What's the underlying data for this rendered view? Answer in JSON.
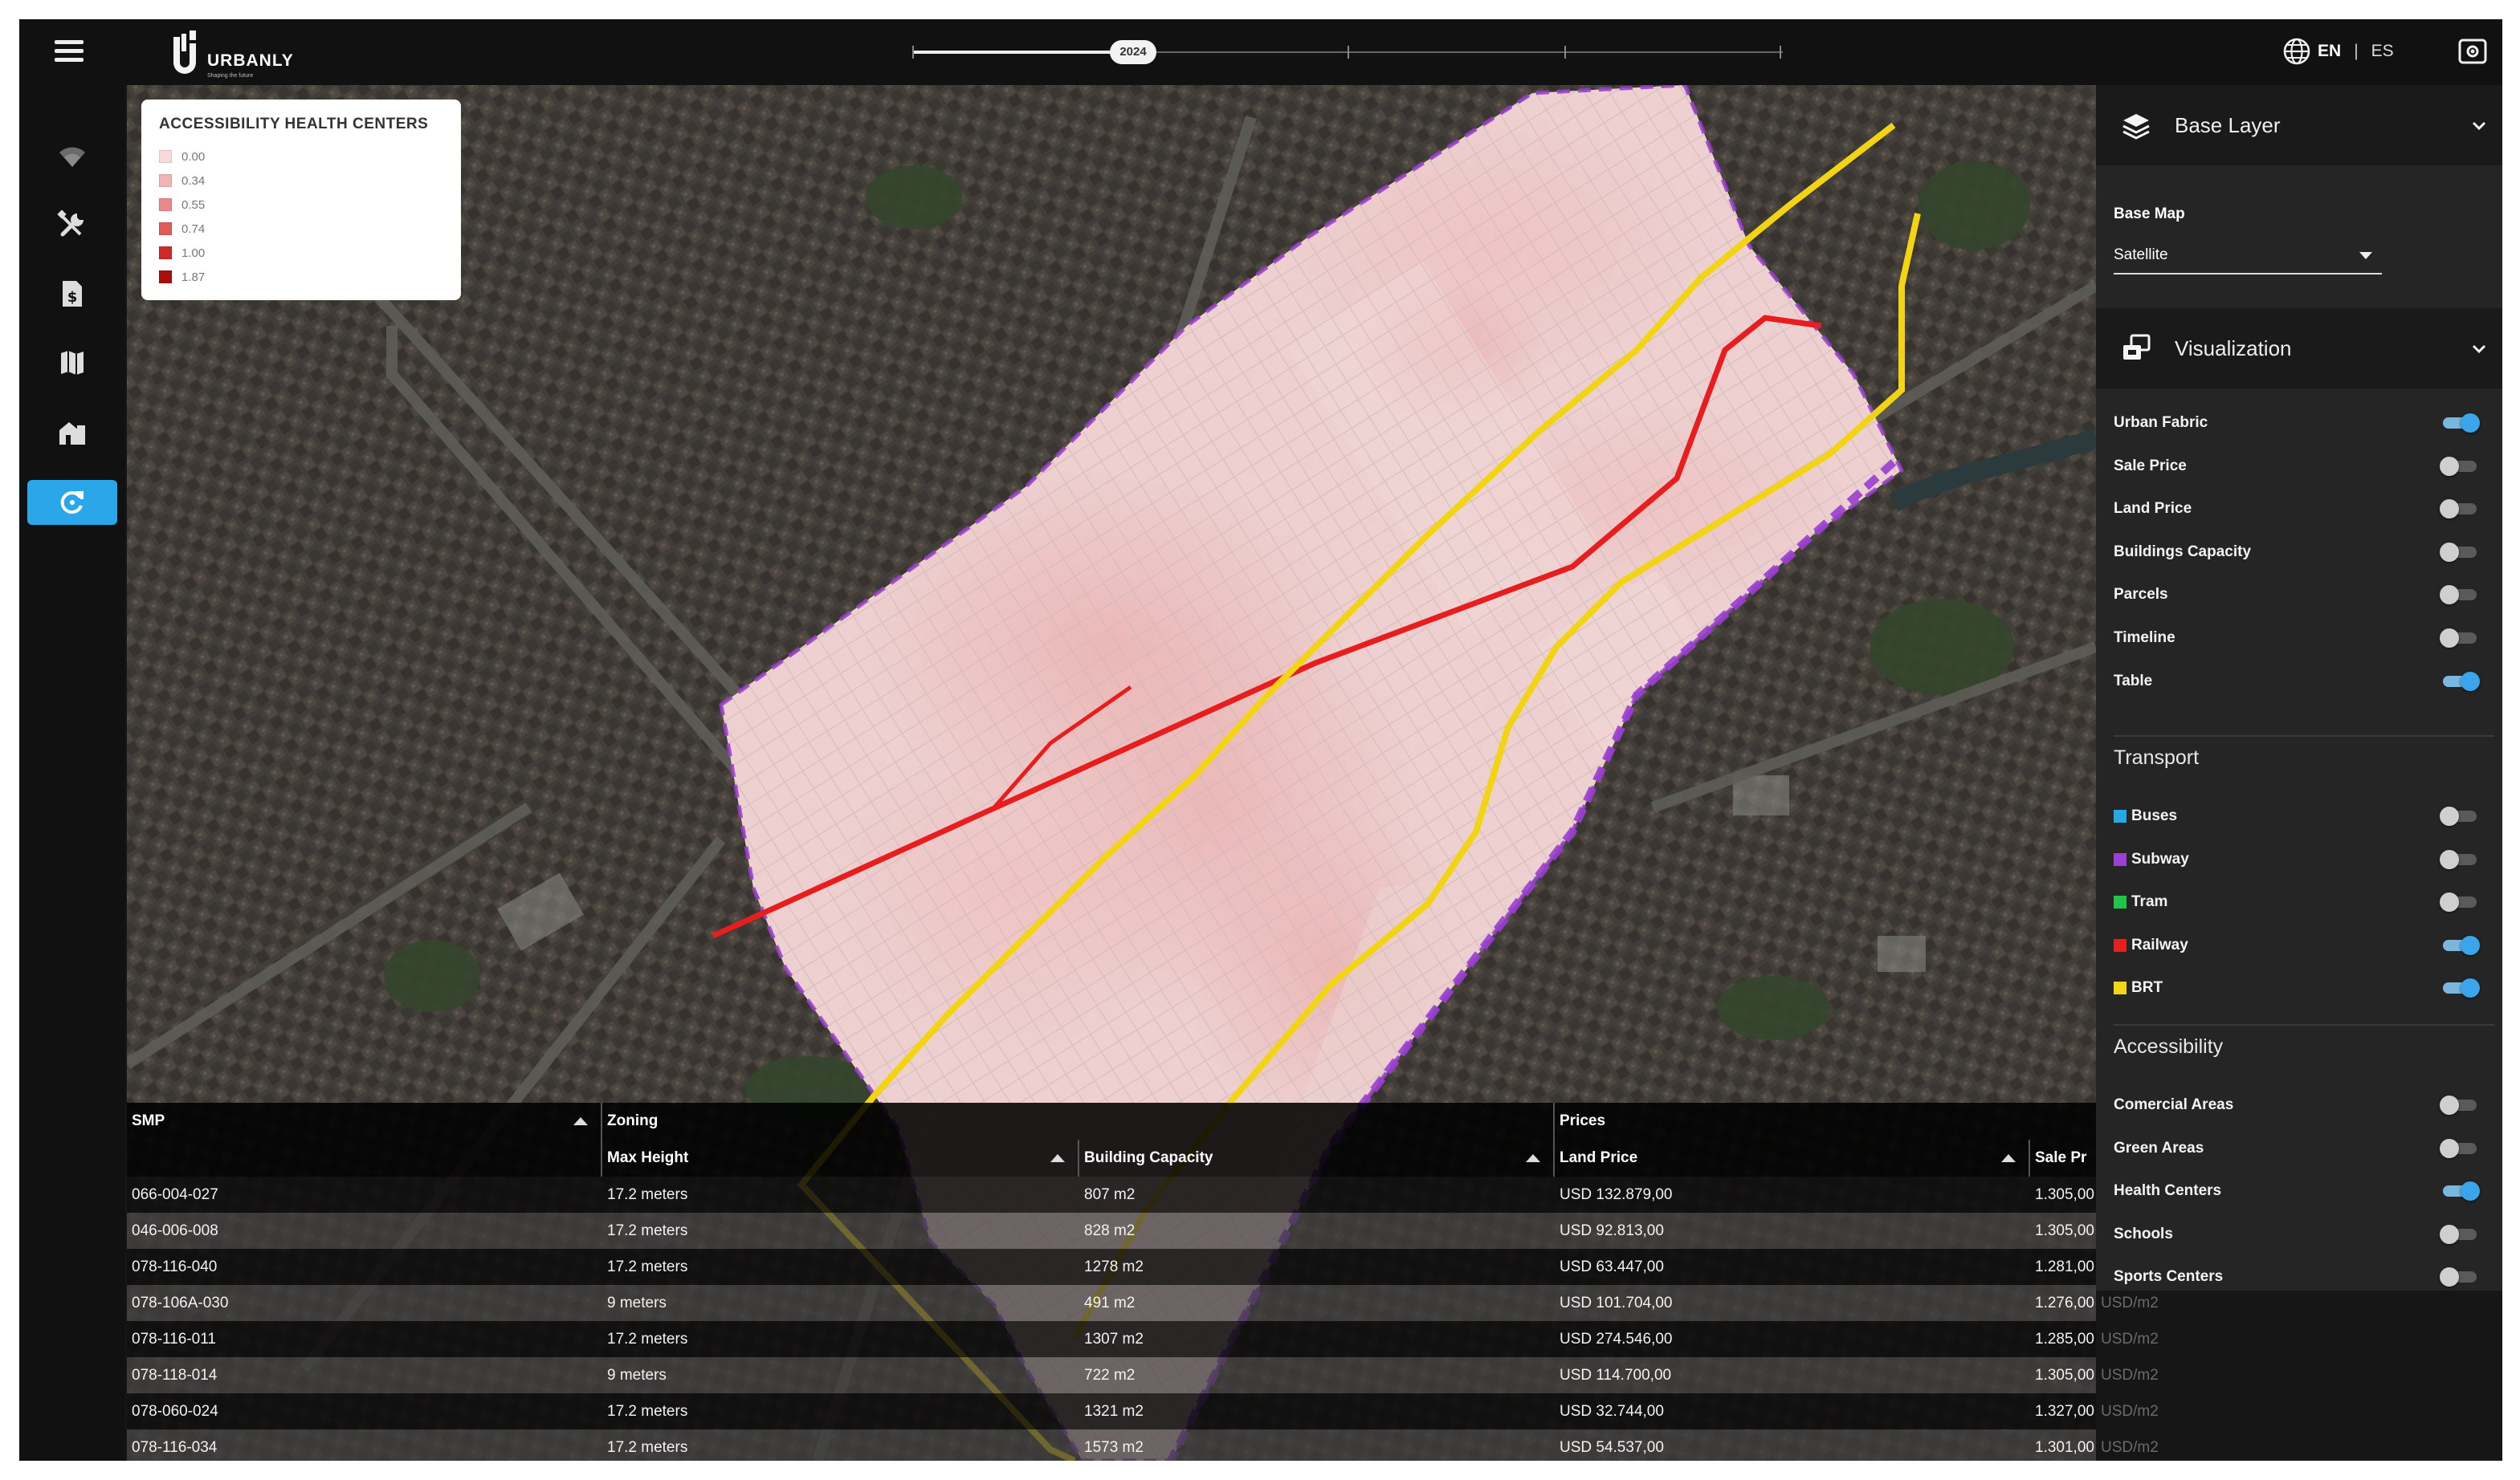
{
  "app": {
    "brand": "URBANLY",
    "tagline": "Shaping the future",
    "timeline_year": "2024"
  },
  "language": {
    "active": "EN",
    "other": "ES"
  },
  "sidebar": {
    "items": [
      {
        "name": "wifi",
        "icon": "wifi-icon"
      },
      {
        "name": "tools",
        "icon": "tools-icon"
      },
      {
        "name": "document",
        "icon": "document-dollar-icon"
      },
      {
        "name": "map",
        "icon": "map-icon"
      },
      {
        "name": "buildings",
        "icon": "buildings-icon"
      },
      {
        "name": "refresh",
        "icon": "refresh-icon",
        "active": true
      }
    ]
  },
  "legend": {
    "title": "ACCESSIBILITY HEALTH CENTERS",
    "items": [
      {
        "label": "0.00",
        "color": "#f7dbdb"
      },
      {
        "label": "0.34",
        "color": "#f1b4b4"
      },
      {
        "label": "0.55",
        "color": "#e98a8a"
      },
      {
        "label": "0.74",
        "color": "#df5c5c"
      },
      {
        "label": "1.00",
        "color": "#cc2a2a"
      },
      {
        "label": "1.87",
        "color": "#a50f0f"
      }
    ]
  },
  "panel": {
    "base_layer": {
      "title": "Base Layer",
      "field_label": "Base Map",
      "value": "Satellite"
    },
    "visualization": {
      "title": "Visualization",
      "toggles": [
        {
          "label": "Urban Fabric",
          "on": true
        },
        {
          "label": "Sale Price",
          "on": false
        },
        {
          "label": "Land Price",
          "on": false
        },
        {
          "label": "Buildings Capacity",
          "on": false
        },
        {
          "label": "Parcels",
          "on": false
        },
        {
          "label": "Timeline",
          "on": false
        },
        {
          "label": "Table",
          "on": true
        }
      ]
    },
    "transport": {
      "title": "Transport",
      "toggles": [
        {
          "label": "Buses",
          "color": "#29a8e6",
          "on": false
        },
        {
          "label": "Subway",
          "color": "#9b3fd8",
          "on": false
        },
        {
          "label": "Tram",
          "color": "#22c44a",
          "on": false
        },
        {
          "label": "Railway",
          "color": "#e62020",
          "on": true
        },
        {
          "label": "BRT",
          "color": "#f1d516",
          "on": true
        }
      ]
    },
    "accessibility": {
      "title": "Accessibility",
      "toggles": [
        {
          "label": "Comercial Areas",
          "on": false
        },
        {
          "label": "Green Areas",
          "on": false
        },
        {
          "label": "Health Centers",
          "on": true
        },
        {
          "label": "Schools",
          "on": false
        },
        {
          "label": "Sports Centers",
          "on": false
        }
      ]
    }
  },
  "table": {
    "groups": {
      "smp": "SMP",
      "zoning": "Zoning",
      "prices": "Prices"
    },
    "columns": {
      "max_height": "Max Height",
      "building_capacity": "Building Capacity",
      "land_price": "Land Price",
      "sale_price": "Sale Pr"
    },
    "rows": [
      {
        "smp": "066-004-027",
        "max_height": "17.2 meters",
        "capacity": "807 m2",
        "land_price": "USD 132.879,00",
        "sale_price": "1.305,00",
        "sale_unit": ""
      },
      {
        "smp": "046-006-008",
        "max_height": "17.2 meters",
        "capacity": "828 m2",
        "land_price": "USD 92.813,00",
        "sale_price": "1.305,00",
        "sale_unit": ""
      },
      {
        "smp": "078-116-040",
        "max_height": "17.2 meters",
        "capacity": "1278 m2",
        "land_price": "USD 63.447,00",
        "sale_price": "1.281,00",
        "sale_unit": ""
      },
      {
        "smp": "078-106A-030",
        "max_height": "9 meters",
        "capacity": "491 m2",
        "land_price": "USD 101.704,00",
        "sale_price": "1.276,00",
        "sale_unit": "USD/m2"
      },
      {
        "smp": "078-116-011",
        "max_height": "17.2 meters",
        "capacity": "1307 m2",
        "land_price": "USD 274.546,00",
        "sale_price": "1.285,00",
        "sale_unit": "USD/m2"
      },
      {
        "smp": "078-118-014",
        "max_height": "9 meters",
        "capacity": "722 m2",
        "land_price": "USD 114.700,00",
        "sale_price": "1.305,00",
        "sale_unit": "USD/m2"
      },
      {
        "smp": "078-060-024",
        "max_height": "17.2 meters",
        "capacity": "1321 m2",
        "land_price": "USD 32.744,00",
        "sale_price": "1.327,00",
        "sale_unit": "USD/m2"
      },
      {
        "smp": "078-116-034",
        "max_height": "17.2 meters",
        "capacity": "1573 m2",
        "land_price": "USD 54.537,00",
        "sale_price": "1.301,00",
        "sale_unit": "USD/m2"
      }
    ]
  }
}
